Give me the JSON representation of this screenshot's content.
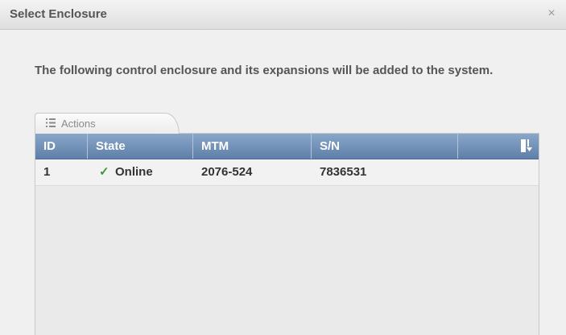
{
  "dialog": {
    "title": "Select Enclosure",
    "close_label": "×",
    "message": "The following control enclosure and its expansions will be added to the system."
  },
  "toolbar": {
    "actions_label": "Actions",
    "actions_icon": "list-icon"
  },
  "table": {
    "columns": [
      "ID",
      "State",
      "MTM",
      "S/N"
    ],
    "config_icon": "column-config-icon",
    "rows": [
      {
        "id": "1",
        "state": "Online",
        "state_icon": "checkmark-icon",
        "mtm": "2076-524",
        "sn": "7836531"
      }
    ]
  },
  "colors": {
    "header_blue": "#6f8fb6",
    "online_green": "#3a9a3a"
  }
}
